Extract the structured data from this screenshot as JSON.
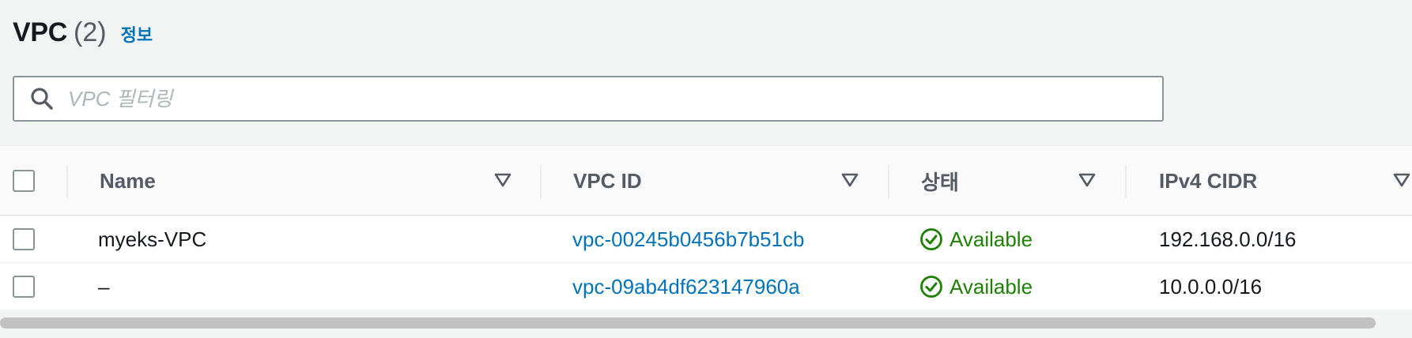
{
  "header": {
    "title": "VPC",
    "count": "(2)",
    "info_link": "정보"
  },
  "search": {
    "placeholder": "VPC 필터링",
    "value": ""
  },
  "table": {
    "columns": [
      {
        "label": "Name"
      },
      {
        "label": "VPC ID"
      },
      {
        "label": "상태"
      },
      {
        "label": "IPv4 CIDR"
      }
    ],
    "rows": [
      {
        "name": "myeks-VPC",
        "vpc_id": "vpc-00245b0456b7b51cb",
        "status": "Available",
        "cidr": "192.168.0.0/16"
      },
      {
        "name": "–",
        "vpc_id": "vpc-09ab4df623147960a",
        "status": "Available",
        "cidr": "10.0.0.0/16"
      }
    ]
  },
  "colors": {
    "link": "#0073bb",
    "status_available": "#1d8102",
    "header_text": "#545b64"
  },
  "icons": {
    "search": "search-icon",
    "sort": "caret-down-icon",
    "status": "check-circle-icon"
  }
}
